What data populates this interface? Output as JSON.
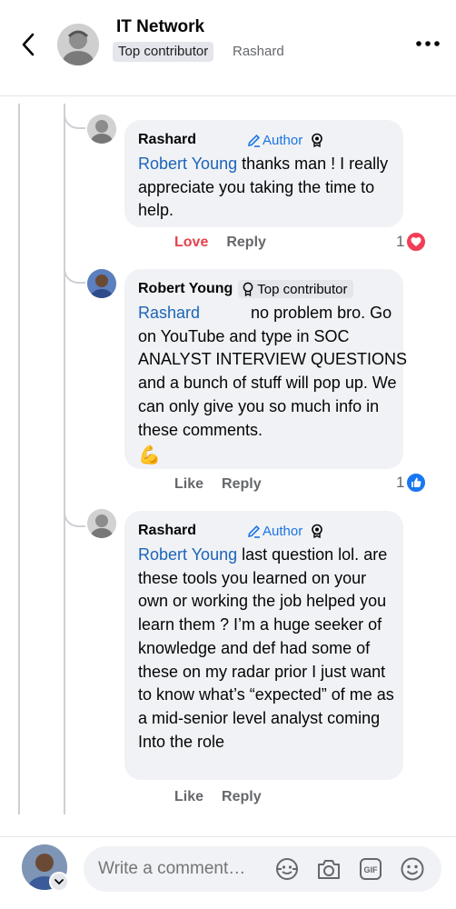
{
  "header": {
    "group_name": "IT Network",
    "badge": "Top contributor",
    "username": "Rashard"
  },
  "comments": [
    {
      "author": "Rashard",
      "tag": "Author",
      "mention": "Robert Young",
      "text": " thanks man ! I really appreciate you taking the time to help.",
      "reaction_action": "Love",
      "reply_label": "Reply",
      "reaction_count": "1",
      "reaction_icon": "heart-icon"
    },
    {
      "author": "Robert Young",
      "tag": "Top contributor",
      "mention": "Rashard",
      "text": "no problem bro. Go on YouTube and type in SOC ANALYST INTERVIEW QUESTIONS and a bunch of stuff will pop up. We can only give you so much info in these comments.",
      "emoji": "💪",
      "reaction_action": "Like",
      "reply_label": "Reply",
      "reaction_count": "1",
      "reaction_icon": "like-icon"
    },
    {
      "author": "Rashard",
      "tag": "Author",
      "mention": "Robert Young",
      "text": " last question lol. are these tools you learned on your own or working the job helped you learn them ? I’m a huge seeker of knowledge and def had some of these on my radar prior I just want to know what’s “expected” of me as a mid-senior level analyst coming Into the role",
      "reaction_action": "Like",
      "reply_label": "Reply"
    }
  ],
  "composer": {
    "placeholder": "Write a comment…",
    "icons": [
      "avatar-frame-icon",
      "camera-icon",
      "gif-icon",
      "emoji-icon"
    ]
  },
  "colors": {
    "link": "#1c64b8",
    "author_tag": "#1b74e4",
    "love": "#e4434b",
    "like": "#1877f2"
  }
}
